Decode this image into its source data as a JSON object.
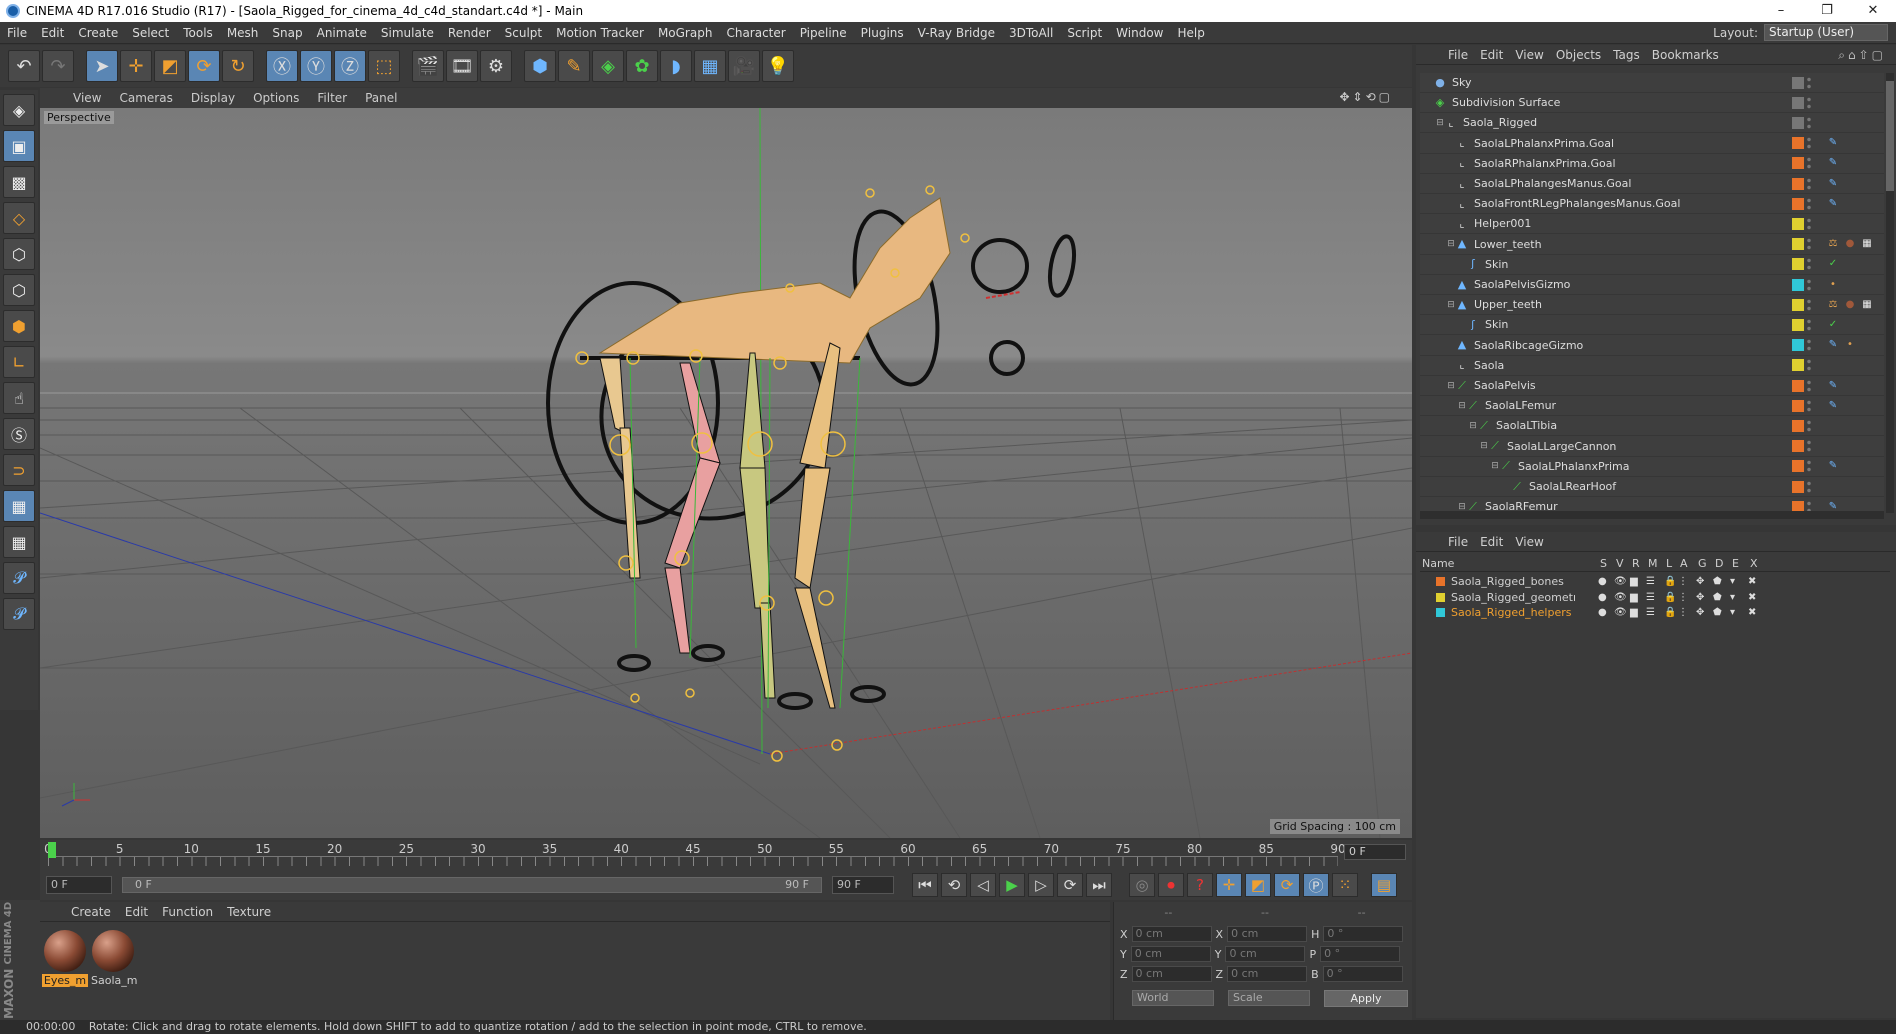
{
  "window": {
    "title": "CINEMA 4D R17.016 Studio (R17) - [Saola_Rigged_for_cinema_4d_c4d_standart.c4d *] - Main",
    "controls": [
      "–",
      "❐",
      "✕"
    ]
  },
  "menubar": {
    "items": [
      "File",
      "Edit",
      "Create",
      "Select",
      "Tools",
      "Mesh",
      "Snap",
      "Animate",
      "Simulate",
      "Render",
      "Sculpt",
      "Motion Tracker",
      "MoGraph",
      "Character",
      "Pipeline",
      "Plugins",
      "V-Ray Bridge",
      "3DToAll",
      "Script",
      "Window",
      "Help"
    ],
    "layout_label": "Layout:",
    "layout_value": "Startup (User)"
  },
  "viewport": {
    "menu": [
      "View",
      "Cameras",
      "Display",
      "Options",
      "Filter",
      "Panel"
    ],
    "nav_icons": "✥⇕⟲▢",
    "label": "Perspective",
    "grid_spacing": "Grid Spacing : 100 cm"
  },
  "timeline": {
    "ticks": [
      "0",
      "5",
      "10",
      "15",
      "20",
      "25",
      "30",
      "35",
      "40",
      "45",
      "50",
      "55",
      "60",
      "65",
      "70",
      "75",
      "80",
      "85",
      "90"
    ],
    "current_frame": "0 F"
  },
  "playback": {
    "start_field": "0 F",
    "range_start": "0 F",
    "range_end": "90 F",
    "end_field": "90 F"
  },
  "material_manager": {
    "menu": [
      "Create",
      "Edit",
      "Function",
      "Texture"
    ],
    "materials": [
      {
        "name": "Eyes_m",
        "selected": true
      },
      {
        "name": "Saola_m",
        "selected": false
      }
    ],
    "brand_top": "MAXON",
    "brand_bottom": "CINEMA 4D"
  },
  "coordinates": {
    "headers": [
      "--",
      "--",
      "--"
    ],
    "rows": [
      {
        "a": "X",
        "av": "0 cm",
        "b": "X",
        "bv": "0 cm",
        "c": "H",
        "cv": "0 °"
      },
      {
        "a": "Y",
        "av": "0 cm",
        "b": "Y",
        "bv": "0 cm",
        "c": "P",
        "cv": "0 °"
      },
      {
        "a": "Z",
        "av": "0 cm",
        "b": "Z",
        "bv": "0 cm",
        "c": "B",
        "cv": "0 °"
      }
    ],
    "space": "World",
    "mode": "Scale",
    "apply": "Apply"
  },
  "status": {
    "time": "00:00:00",
    "text": "Rotate: Click and drag to rotate elements. Hold down SHIFT to add to quantize rotation / add to the selection in point mode, CTRL to remove."
  },
  "object_manager": {
    "menu": [
      "File",
      "Edit",
      "View",
      "Objects",
      "Tags",
      "Bookmarks"
    ],
    "objects": [
      {
        "name": "Sky",
        "depth": 0,
        "icon": "sky-icon",
        "color": "#777777",
        "tags": []
      },
      {
        "name": "Subdivision Surface",
        "depth": 0,
        "icon": "subdivision-icon",
        "color": "#777777",
        "tags": []
      },
      {
        "name": "Saola_Rigged",
        "depth": 1,
        "icon": "null-icon",
        "color": "#777777",
        "tags": []
      },
      {
        "name": "SaolaLPhalanxPrima.Goal",
        "depth": 2,
        "icon": "null-icon",
        "color": "#e8732a",
        "tags": [
          "ik"
        ]
      },
      {
        "name": "SaolaRPhalanxPrima.Goal",
        "depth": 2,
        "icon": "null-icon",
        "color": "#e8732a",
        "tags": [
          "ik"
        ]
      },
      {
        "name": "SaolaLPhalangesManus.Goal",
        "depth": 2,
        "icon": "null-icon",
        "color": "#e8732a",
        "tags": [
          "ik"
        ]
      },
      {
        "name": "SaolaFrontRLegPhalangesManus.Goal",
        "depth": 2,
        "icon": "null-icon",
        "color": "#e8732a",
        "tags": [
          "ik"
        ]
      },
      {
        "name": "Helper001",
        "depth": 2,
        "icon": "null-icon",
        "color": "#e0d030",
        "tags": []
      },
      {
        "name": "Lower_teeth",
        "depth": 2,
        "icon": "mesh-icon",
        "color": "#e0d030",
        "tags": [
          "weight",
          "material",
          "checker"
        ]
      },
      {
        "name": "Skin",
        "depth": 3,
        "icon": "skin-icon",
        "color": "#e0d030",
        "tags": [
          "check"
        ]
      },
      {
        "name": "SaolaPelvisGizmo",
        "depth": 2,
        "icon": "mesh-icon",
        "color": "#30c8d8",
        "tags": [
          "dot"
        ]
      },
      {
        "name": "Upper_teeth",
        "depth": 2,
        "icon": "mesh-icon",
        "color": "#e0d030",
        "tags": [
          "weight",
          "material",
          "checker"
        ]
      },
      {
        "name": "Skin",
        "depth": 3,
        "icon": "skin-icon",
        "color": "#e0d030",
        "tags": [
          "check"
        ]
      },
      {
        "name": "SaolaRibcageGizmo",
        "depth": 2,
        "icon": "mesh-icon",
        "color": "#30c8d8",
        "tags": [
          "ik",
          "dot"
        ]
      },
      {
        "name": "Saola",
        "depth": 2,
        "icon": "null-icon",
        "color": "#e0d030",
        "tags": []
      },
      {
        "name": "SaolaPelvis",
        "depth": 2,
        "icon": "joint-icon",
        "color": "#e8732a",
        "tags": [
          "ik"
        ]
      },
      {
        "name": "SaolaLFemur",
        "depth": 3,
        "icon": "joint-icon",
        "color": "#e8732a",
        "tags": [
          "ik"
        ]
      },
      {
        "name": "SaolaLTibia",
        "depth": 4,
        "icon": "joint-icon",
        "color": "#e8732a",
        "tags": []
      },
      {
        "name": "SaolaLLargeCannon",
        "depth": 5,
        "icon": "joint-icon",
        "color": "#e8732a",
        "tags": []
      },
      {
        "name": "SaolaLPhalanxPrima",
        "depth": 6,
        "icon": "joint-icon",
        "color": "#e8732a",
        "tags": [
          "ik"
        ]
      },
      {
        "name": "SaolaLRearHoof",
        "depth": 7,
        "icon": "joint-icon",
        "color": "#e8732a",
        "tags": []
      },
      {
        "name": "SaolaRFemur",
        "depth": 3,
        "icon": "joint-icon",
        "color": "#e8732a",
        "tags": [
          "ik"
        ]
      }
    ]
  },
  "layer_manager": {
    "menu": [
      "File",
      "Edit",
      "View"
    ],
    "columns": [
      "Name",
      "S",
      "V",
      "R",
      "M",
      "L",
      "A",
      "G",
      "D",
      "E",
      "X"
    ],
    "layers": [
      {
        "name": "Saola_Rigged_bones",
        "color": "#e8732a",
        "selected": false
      },
      {
        "name": "Saola_Rigged_geometru",
        "color": "#e0d030",
        "selected": false
      },
      {
        "name": "Saola_Rigged_helpers",
        "color": "#30c8d8",
        "selected": true
      }
    ]
  },
  "colors": {
    "accent": "#f0a030",
    "selection": "#5a86b4"
  }
}
